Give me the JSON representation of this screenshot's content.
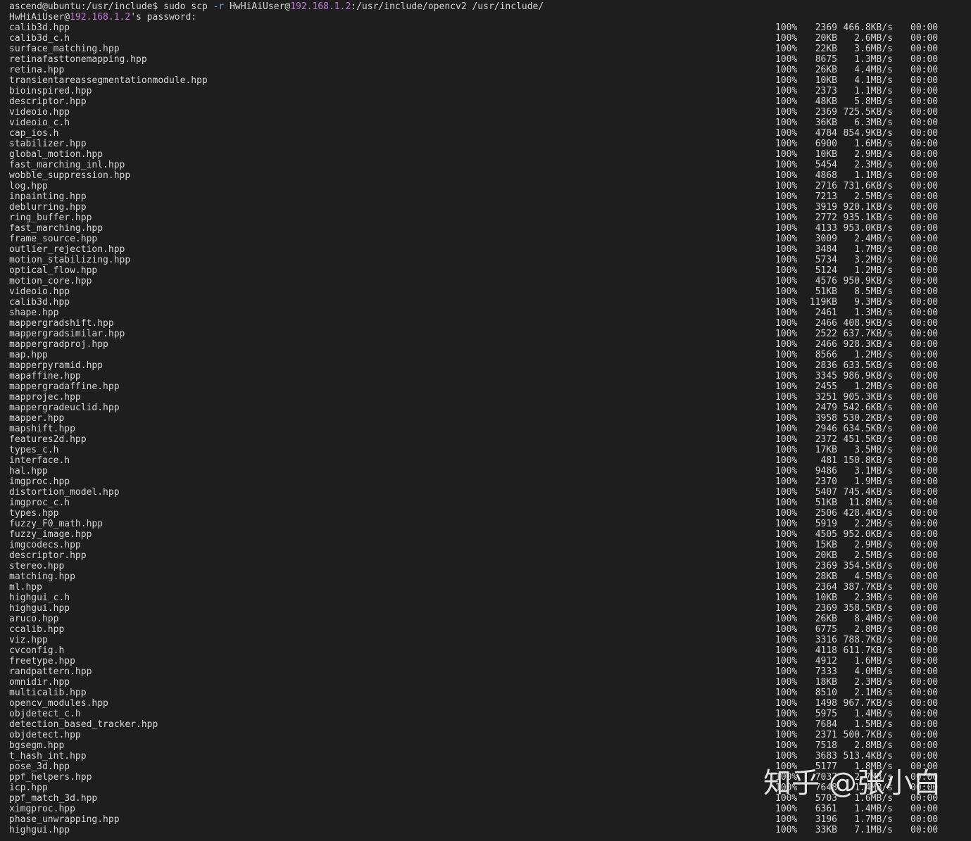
{
  "prompt": {
    "user_host": "ascend@ubuntu:/usr/include$",
    "cmd_pre": " sudo scp ",
    "flag": "-r",
    "cmd_user": " HwHiAiUser@",
    "ip": "192.168.1.2",
    "cmd_post": ":/usr/include/opencv2 /usr/include/"
  },
  "password_prompt": {
    "user": "HwHiAiUser@",
    "ip": "192.168.1.2",
    "rest": "'s password:"
  },
  "files": [
    {
      "name": "calib3d.hpp",
      "pct": "100%",
      "size": "2369",
      "speed": "466.8KB/s",
      "eta": "00:00"
    },
    {
      "name": "calib3d_c.h",
      "pct": "100%",
      "size": "20KB",
      "speed": "2.6MB/s",
      "eta": "00:00"
    },
    {
      "name": "surface_matching.hpp",
      "pct": "100%",
      "size": "22KB",
      "speed": "3.6MB/s",
      "eta": "00:00"
    },
    {
      "name": "retinafasttonemapping.hpp",
      "pct": "100%",
      "size": "8675",
      "speed": "1.3MB/s",
      "eta": "00:00"
    },
    {
      "name": "retina.hpp",
      "pct": "100%",
      "size": "26KB",
      "speed": "4.4MB/s",
      "eta": "00:00"
    },
    {
      "name": "transientareassegmentationmodule.hpp",
      "pct": "100%",
      "size": "10KB",
      "speed": "4.1MB/s",
      "eta": "00:00"
    },
    {
      "name": "bioinspired.hpp",
      "pct": "100%",
      "size": "2373",
      "speed": "1.1MB/s",
      "eta": "00:00"
    },
    {
      "name": "descriptor.hpp",
      "pct": "100%",
      "size": "48KB",
      "speed": "5.8MB/s",
      "eta": "00:00"
    },
    {
      "name": "videoio.hpp",
      "pct": "100%",
      "size": "2369",
      "speed": "725.5KB/s",
      "eta": "00:00"
    },
    {
      "name": "videoio_c.h",
      "pct": "100%",
      "size": "36KB",
      "speed": "6.3MB/s",
      "eta": "00:00"
    },
    {
      "name": "cap_ios.h",
      "pct": "100%",
      "size": "4784",
      "speed": "854.9KB/s",
      "eta": "00:00"
    },
    {
      "name": "stabilizer.hpp",
      "pct": "100%",
      "size": "6900",
      "speed": "1.6MB/s",
      "eta": "00:00"
    },
    {
      "name": "global_motion.hpp",
      "pct": "100%",
      "size": "10KB",
      "speed": "2.9MB/s",
      "eta": "00:00"
    },
    {
      "name": "fast_marching_inl.hpp",
      "pct": "100%",
      "size": "5454",
      "speed": "2.3MB/s",
      "eta": "00:00"
    },
    {
      "name": "wobble_suppression.hpp",
      "pct": "100%",
      "size": "4868",
      "speed": "1.1MB/s",
      "eta": "00:00"
    },
    {
      "name": "log.hpp",
      "pct": "100%",
      "size": "2716",
      "speed": "731.6KB/s",
      "eta": "00:00"
    },
    {
      "name": "inpainting.hpp",
      "pct": "100%",
      "size": "7213",
      "speed": "2.5MB/s",
      "eta": "00:00"
    },
    {
      "name": "deblurring.hpp",
      "pct": "100%",
      "size": "3919",
      "speed": "920.1KB/s",
      "eta": "00:00"
    },
    {
      "name": "ring_buffer.hpp",
      "pct": "100%",
      "size": "2772",
      "speed": "935.1KB/s",
      "eta": "00:00"
    },
    {
      "name": "fast_marching.hpp",
      "pct": "100%",
      "size": "4133",
      "speed": "953.0KB/s",
      "eta": "00:00"
    },
    {
      "name": "frame_source.hpp",
      "pct": "100%",
      "size": "3009",
      "speed": "2.4MB/s",
      "eta": "00:00"
    },
    {
      "name": "outlier_rejection.hpp",
      "pct": "100%",
      "size": "3484",
      "speed": "1.7MB/s",
      "eta": "00:00"
    },
    {
      "name": "motion_stabilizing.hpp",
      "pct": "100%",
      "size": "5734",
      "speed": "3.2MB/s",
      "eta": "00:00"
    },
    {
      "name": "optical_flow.hpp",
      "pct": "100%",
      "size": "5124",
      "speed": "1.2MB/s",
      "eta": "00:00"
    },
    {
      "name": "motion_core.hpp",
      "pct": "100%",
      "size": "4576",
      "speed": "950.9KB/s",
      "eta": "00:00"
    },
    {
      "name": "videoio.hpp",
      "pct": "100%",
      "size": "51KB",
      "speed": "8.5MB/s",
      "eta": "00:00"
    },
    {
      "name": "calib3d.hpp",
      "pct": "100%",
      "size": "119KB",
      "speed": "9.3MB/s",
      "eta": "00:00"
    },
    {
      "name": "shape.hpp",
      "pct": "100%",
      "size": "2461",
      "speed": "1.3MB/s",
      "eta": "00:00"
    },
    {
      "name": "mappergradshift.hpp",
      "pct": "100%",
      "size": "2466",
      "speed": "408.9KB/s",
      "eta": "00:00"
    },
    {
      "name": "mappergradsimilar.hpp",
      "pct": "100%",
      "size": "2522",
      "speed": "637.7KB/s",
      "eta": "00:00"
    },
    {
      "name": "mappergradproj.hpp",
      "pct": "100%",
      "size": "2466",
      "speed": "928.3KB/s",
      "eta": "00:00"
    },
    {
      "name": "map.hpp",
      "pct": "100%",
      "size": "8566",
      "speed": "1.2MB/s",
      "eta": "00:00"
    },
    {
      "name": "mapperpyramid.hpp",
      "pct": "100%",
      "size": "2836",
      "speed": "633.5KB/s",
      "eta": "00:00"
    },
    {
      "name": "mapaffine.hpp",
      "pct": "100%",
      "size": "3345",
      "speed": "986.9KB/s",
      "eta": "00:00"
    },
    {
      "name": "mappergradaffine.hpp",
      "pct": "100%",
      "size": "2455",
      "speed": "1.2MB/s",
      "eta": "00:00"
    },
    {
      "name": "mapprojec.hpp",
      "pct": "100%",
      "size": "3251",
      "speed": "905.3KB/s",
      "eta": "00:00"
    },
    {
      "name": "mappergradeuclid.hpp",
      "pct": "100%",
      "size": "2479",
      "speed": "542.6KB/s",
      "eta": "00:00"
    },
    {
      "name": "mapper.hpp",
      "pct": "100%",
      "size": "3958",
      "speed": "530.2KB/s",
      "eta": "00:00"
    },
    {
      "name": "mapshift.hpp",
      "pct": "100%",
      "size": "2946",
      "speed": "634.5KB/s",
      "eta": "00:00"
    },
    {
      "name": "features2d.hpp",
      "pct": "100%",
      "size": "2372",
      "speed": "451.5KB/s",
      "eta": "00:00"
    },
    {
      "name": "types_c.h",
      "pct": "100%",
      "size": "17KB",
      "speed": "3.5MB/s",
      "eta": "00:00"
    },
    {
      "name": "interface.h",
      "pct": "100%",
      "size": "481",
      "speed": "150.8KB/s",
      "eta": "00:00"
    },
    {
      "name": "hal.hpp",
      "pct": "100%",
      "size": "9486",
      "speed": "3.1MB/s",
      "eta": "00:00"
    },
    {
      "name": "imgproc.hpp",
      "pct": "100%",
      "size": "2370",
      "speed": "1.9MB/s",
      "eta": "00:00"
    },
    {
      "name": "distortion_model.hpp",
      "pct": "100%",
      "size": "5407",
      "speed": "745.4KB/s",
      "eta": "00:00"
    },
    {
      "name": "imgproc_c.h",
      "pct": "100%",
      "size": "51KB",
      "speed": "11.8MB/s",
      "eta": "00:00"
    },
    {
      "name": "types.hpp",
      "pct": "100%",
      "size": "2506",
      "speed": "428.4KB/s",
      "eta": "00:00"
    },
    {
      "name": "fuzzy_F0_math.hpp",
      "pct": "100%",
      "size": "5919",
      "speed": "2.2MB/s",
      "eta": "00:00"
    },
    {
      "name": "fuzzy_image.hpp",
      "pct": "100%",
      "size": "4505",
      "speed": "952.0KB/s",
      "eta": "00:00"
    },
    {
      "name": "imgcodecs.hpp",
      "pct": "100%",
      "size": "15KB",
      "speed": "2.9MB/s",
      "eta": "00:00"
    },
    {
      "name": "descriptor.hpp",
      "pct": "100%",
      "size": "20KB",
      "speed": "2.5MB/s",
      "eta": "00:00"
    },
    {
      "name": "stereo.hpp",
      "pct": "100%",
      "size": "2369",
      "speed": "354.5KB/s",
      "eta": "00:00"
    },
    {
      "name": "matching.hpp",
      "pct": "100%",
      "size": "28KB",
      "speed": "4.5MB/s",
      "eta": "00:00"
    },
    {
      "name": "ml.hpp",
      "pct": "100%",
      "size": "2364",
      "speed": "387.7KB/s",
      "eta": "00:00"
    },
    {
      "name": "highgui_c.h",
      "pct": "100%",
      "size": "10KB",
      "speed": "2.3MB/s",
      "eta": "00:00"
    },
    {
      "name": "highgui.hpp",
      "pct": "100%",
      "size": "2369",
      "speed": "358.5KB/s",
      "eta": "00:00"
    },
    {
      "name": "aruco.hpp",
      "pct": "100%",
      "size": "26KB",
      "speed": "8.4MB/s",
      "eta": "00:00"
    },
    {
      "name": "ccalib.hpp",
      "pct": "100%",
      "size": "6775",
      "speed": "2.8MB/s",
      "eta": "00:00"
    },
    {
      "name": "viz.hpp",
      "pct": "100%",
      "size": "3316",
      "speed": "788.7KB/s",
      "eta": "00:00"
    },
    {
      "name": "cvconfig.h",
      "pct": "100%",
      "size": "4118",
      "speed": "611.7KB/s",
      "eta": "00:00"
    },
    {
      "name": "freetype.hpp",
      "pct": "100%",
      "size": "4912",
      "speed": "1.6MB/s",
      "eta": "00:00"
    },
    {
      "name": "randpattern.hpp",
      "pct": "100%",
      "size": "7333",
      "speed": "4.0MB/s",
      "eta": "00:00"
    },
    {
      "name": "omnidir.hpp",
      "pct": "100%",
      "size": "18KB",
      "speed": "2.3MB/s",
      "eta": "00:00"
    },
    {
      "name": "multicalib.hpp",
      "pct": "100%",
      "size": "8510",
      "speed": "2.1MB/s",
      "eta": "00:00"
    },
    {
      "name": "opencv_modules.hpp",
      "pct": "100%",
      "size": "1498",
      "speed": "967.7KB/s",
      "eta": "00:00"
    },
    {
      "name": "objdetect_c.h",
      "pct": "100%",
      "size": "5975",
      "speed": "1.4MB/s",
      "eta": "00:00"
    },
    {
      "name": "detection_based_tracker.hpp",
      "pct": "100%",
      "size": "7684",
      "speed": "1.5MB/s",
      "eta": "00:00"
    },
    {
      "name": "objdetect.hpp",
      "pct": "100%",
      "size": "2371",
      "speed": "500.7KB/s",
      "eta": "00:00"
    },
    {
      "name": "bgsegm.hpp",
      "pct": "100%",
      "size": "7518",
      "speed": "2.8MB/s",
      "eta": "00:00"
    },
    {
      "name": "t_hash_int.hpp",
      "pct": "100%",
      "size": "3683",
      "speed": "513.4KB/s",
      "eta": "00:00"
    },
    {
      "name": "pose_3d.hpp",
      "pct": "100%",
      "size": "5177",
      "speed": "1.8MB/s",
      "eta": "00:00"
    },
    {
      "name": "ppf_helpers.hpp",
      "pct": "100%",
      "size": "7037",
      "speed": "2.7MB/s",
      "eta": "00:00"
    },
    {
      "name": "icp.hpp",
      "pct": "100%",
      "size": "7648",
      "speed": "1.4MB/s",
      "eta": "00:00"
    },
    {
      "name": "ppf_match_3d.hpp",
      "pct": "100%",
      "size": "5703",
      "speed": "1.6MB/s",
      "eta": "00:00"
    },
    {
      "name": "ximgproc.hpp",
      "pct": "100%",
      "size": "6361",
      "speed": "1.4MB/s",
      "eta": "00:00"
    },
    {
      "name": "phase_unwrapping.hpp",
      "pct": "100%",
      "size": "3196",
      "speed": "1.7MB/s",
      "eta": "00:00"
    },
    {
      "name": "highgui.hpp",
      "pct": "100%",
      "size": "33KB",
      "speed": "7.1MB/s",
      "eta": "00:00"
    }
  ],
  "watermark": "知乎 @张小白",
  "colors": {
    "background": "#1e1e1e",
    "text": "#d6d6d6",
    "ip": "#c678dd",
    "flag": "#5fa9d9"
  }
}
